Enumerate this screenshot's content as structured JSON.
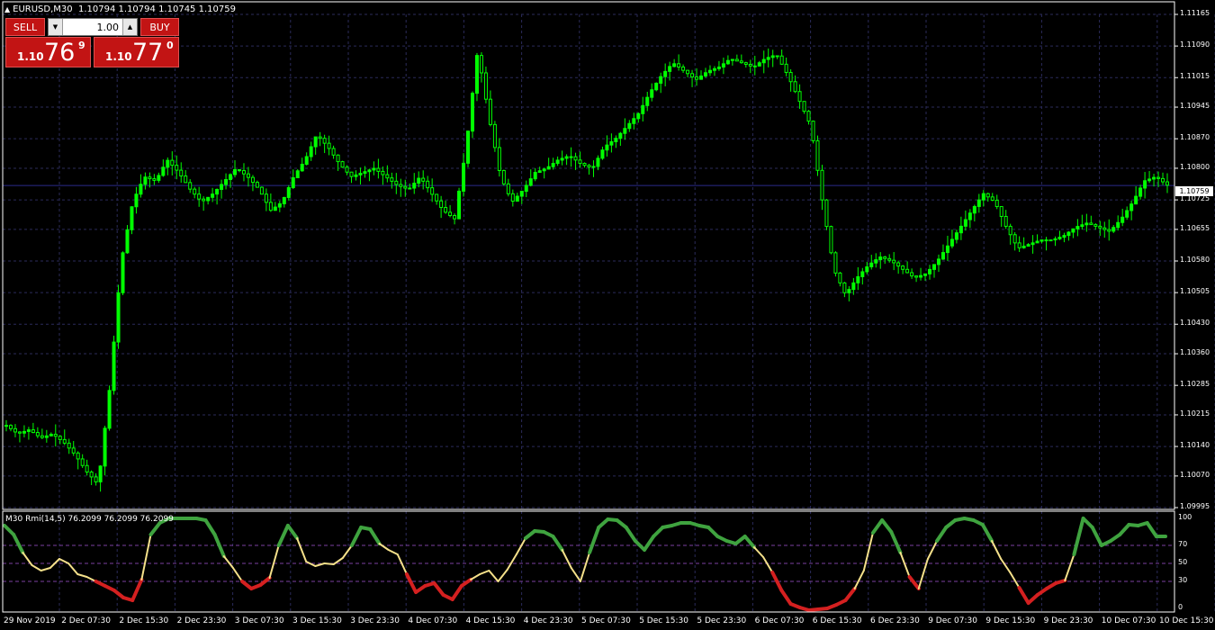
{
  "chart_header": {
    "symbol_tf": "EURUSD,M30",
    "ohlc": "1.10794 1.10794 1.10745 1.10759"
  },
  "one_click": {
    "sell_label": "SELL",
    "buy_label": "BUY",
    "lot_value": "1.00",
    "sell_prefix": "1.10",
    "sell_big": "76",
    "sell_sup": "9",
    "buy_prefix": "1.10",
    "buy_big": "77",
    "buy_sup": "0"
  },
  "current_price": "1.10759",
  "indicator_title": "M30 Rmi(14,5) 76.2099 76.2099 76.2099",
  "colors": {
    "background": "#000000",
    "grid": "#2b2b5a",
    "candles": "#00ff00",
    "rmi_up": "#3fa33f",
    "rmi_neutral": "#f4e08a",
    "rmi_down": "#d42020",
    "level_lines": "#7a3fa0",
    "bid_line": "#2b2b8a"
  },
  "chart_data": {
    "type": "line",
    "price_axis_ticks": [
      "1.11165",
      "1.11090",
      "1.11015",
      "1.10945",
      "1.10870",
      "1.10800",
      "1.10725",
      "1.10655",
      "1.10580",
      "1.10505",
      "1.10430",
      "1.10360",
      "1.10285",
      "1.10215",
      "1.10140",
      "1.10070",
      "1.09995"
    ],
    "price_ylim": [
      1.09995,
      1.11165
    ],
    "time_axis_labels": [
      "29 Nov 2019",
      "2 Dec 07:30",
      "2 Dec 15:30",
      "2 Dec 23:30",
      "3 Dec 07:30",
      "3 Dec 15:30",
      "3 Dec 23:30",
      "4 Dec 07:30",
      "4 Dec 15:30",
      "4 Dec 23:30",
      "5 Dec 07:30",
      "5 Dec 15:30",
      "5 Dec 23:30",
      "6 Dec 07:30",
      "6 Dec 15:30",
      "6 Dec 23:30",
      "9 Dec 07:30",
      "9 Dec 15:30",
      "9 Dec 23:30",
      "10 Dec 07:30",
      "10 Dec 15:30"
    ],
    "series": [
      {
        "name": "EURUSD,M30",
        "values": [
          1.1019,
          1.1017,
          1.1018,
          1.1016,
          1.1017,
          1.1015,
          1.1012,
          1.1008,
          1.1005,
          1.1028,
          1.1058,
          1.1072,
          1.1078,
          1.1077,
          1.1082,
          1.1079,
          1.1075,
          1.1072,
          1.1074,
          1.1077,
          1.108,
          1.1078,
          1.1075,
          1.107,
          1.1072,
          1.1078,
          1.1082,
          1.1088,
          1.1085,
          1.1081,
          1.1078,
          1.1079,
          1.108,
          1.1078,
          1.1076,
          1.1075,
          1.1078,
          1.1074,
          1.107,
          1.1068,
          1.1085,
          1.1108,
          1.1092,
          1.1078,
          1.1072,
          1.1075,
          1.1079,
          1.108,
          1.1082,
          1.1083,
          1.1081,
          1.108,
          1.1085,
          1.1087,
          1.109,
          1.1093,
          1.1098,
          1.1102,
          1.1105,
          1.1103,
          1.1101,
          1.1103,
          1.1104,
          1.1106,
          1.1105,
          1.1104,
          1.1106,
          1.1107,
          1.1102,
          1.1096,
          1.109,
          1.1072,
          1.1056,
          1.105,
          1.1054,
          1.1057,
          1.1059,
          1.1058,
          1.1056,
          1.1054,
          1.1055,
          1.1058,
          1.1062,
          1.1066,
          1.107,
          1.1074,
          1.1072,
          1.1066,
          1.1061,
          1.1062,
          1.1063,
          1.1063,
          1.1064,
          1.1066,
          1.1067,
          1.1066,
          1.1065,
          1.1068,
          1.1072,
          1.1077,
          1.1078,
          1.1076
        ]
      },
      {
        "name": "M30 Rmi(14,5)",
        "values": [
          92,
          82,
          62,
          48,
          42,
          45,
          55,
          50,
          38,
          35,
          30,
          25,
          20,
          12,
          9,
          32,
          82,
          95,
          100,
          100,
          100,
          100,
          98,
          82,
          58,
          45,
          30,
          22,
          26,
          34,
          70,
          92,
          78,
          52,
          47,
          50,
          49,
          56,
          70,
          90,
          88,
          72,
          65,
          60,
          38,
          18,
          25,
          28,
          15,
          10,
          25,
          32,
          38,
          42,
          30,
          43,
          60,
          78,
          86,
          85,
          80,
          65,
          45,
          30,
          62,
          90,
          99,
          98,
          90,
          75,
          65,
          80,
          90,
          92,
          95,
          95,
          92,
          90,
          80,
          75,
          72,
          80,
          68,
          57,
          40,
          20,
          5,
          1,
          -2,
          -1,
          0,
          4,
          9,
          22,
          42,
          84,
          98,
          85,
          62,
          35,
          22,
          55,
          75,
          90,
          98,
          100,
          98,
          93,
          75,
          55,
          40,
          23,
          6,
          15,
          22,
          28,
          31,
          60,
          100,
          90,
          70,
          75,
          82,
          93,
          92,
          95,
          80,
          80
        ]
      }
    ],
    "rmi_ylim": [
      0,
      100
    ],
    "rmi_levels": [
      30,
      50,
      70
    ],
    "rmi_axis_ticks": [
      "100",
      "70",
      "50",
      "30",
      "0"
    ],
    "grid": true
  }
}
